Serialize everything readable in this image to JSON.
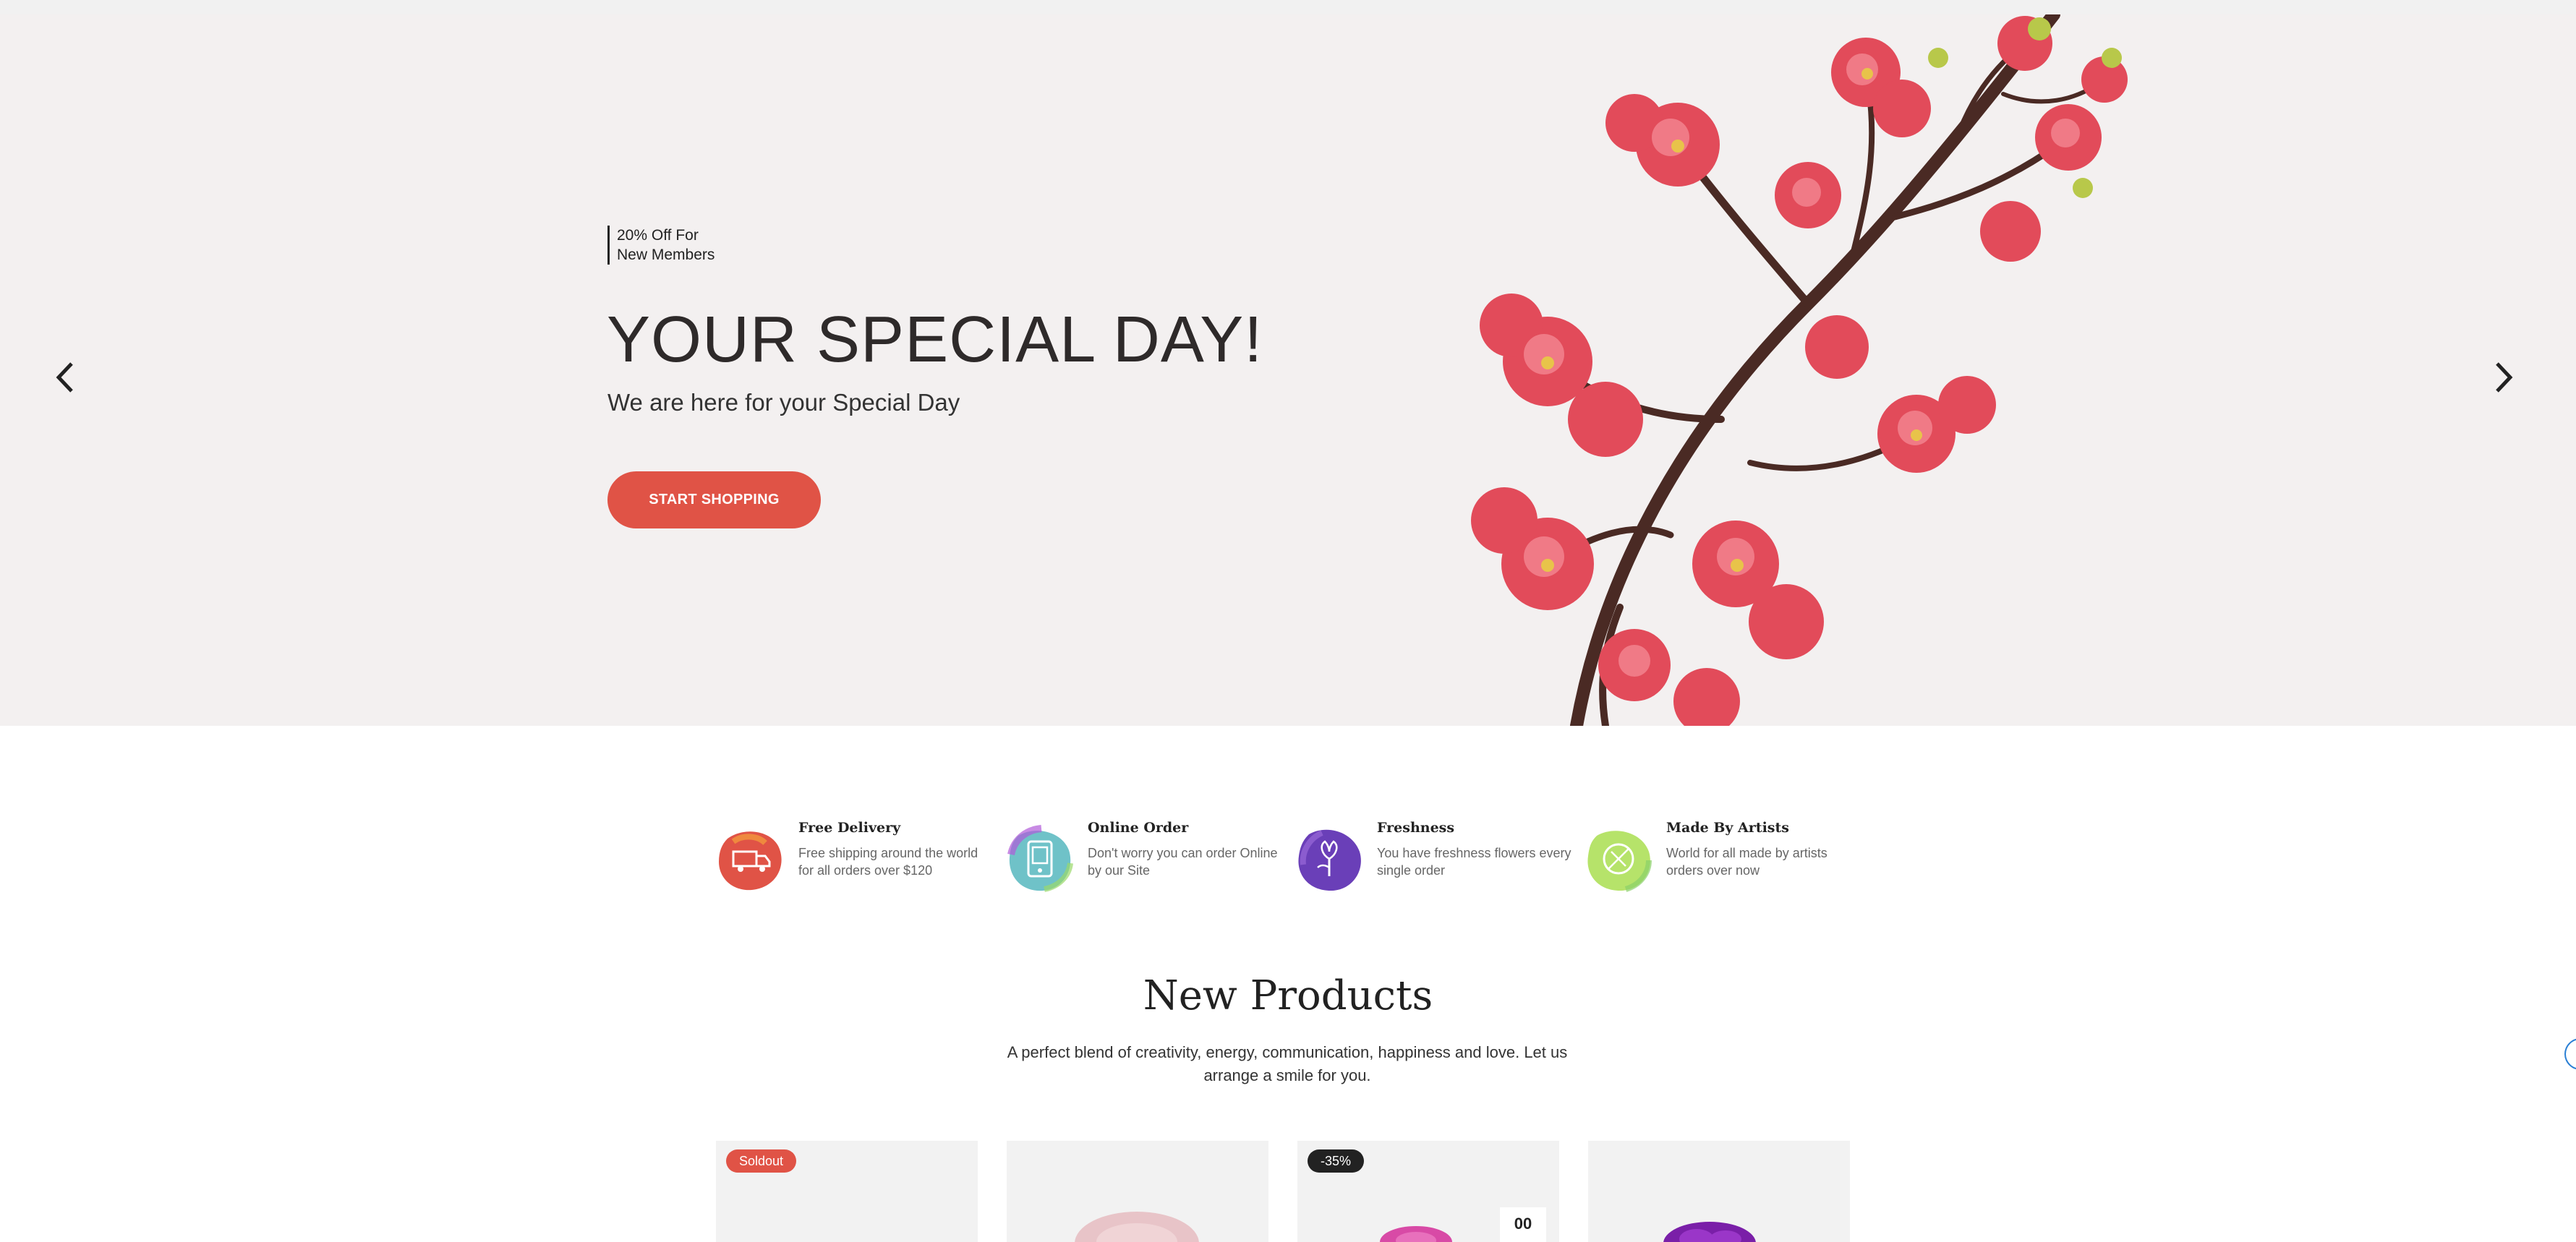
{
  "hero": {
    "promo_line1": "20% Off For",
    "promo_line2": "New Members",
    "title": "YOUR SPECIAL DAY!",
    "subtitle": "We are here for your Special Day",
    "cta_label": "START SHOPPING",
    "prev_icon": "chevron-left-icon",
    "next_icon": "chevron-right-icon"
  },
  "features": [
    {
      "title": "Free Delivery",
      "desc": "Free shipping around the world for all orders over $120",
      "icon": "delivery-truck-icon",
      "color": "#e05346"
    },
    {
      "title": "Online Order",
      "desc": "Don't worry you can order Online by our Site",
      "icon": "online-order-icon",
      "color": "#6fc2c8"
    },
    {
      "title": "Freshness",
      "desc": "You have freshness flowers every single order",
      "icon": "flower-icon",
      "color": "#6a3fb8"
    },
    {
      "title": "Made By Artists",
      "desc": "World for all made by artists orders over now",
      "icon": "leaf-icon",
      "color": "#b6e36a"
    }
  ],
  "products_section": {
    "title": "New Products",
    "description": "A perfect blend of creativity, energy, communication, happiness and love. Let us arrange a smile for you."
  },
  "products": [
    {
      "badge": "Soldout",
      "image": "white-flower"
    },
    {
      "badge": "",
      "image": "pink-rose"
    },
    {
      "badge": "-35%",
      "timer": "00",
      "image": "pink-flower"
    },
    {
      "badge": "",
      "image": "purple-flower"
    }
  ],
  "colors": {
    "accent": "#e05346",
    "hero_bg": "#f3f0f0",
    "text_dark": "#222222"
  }
}
